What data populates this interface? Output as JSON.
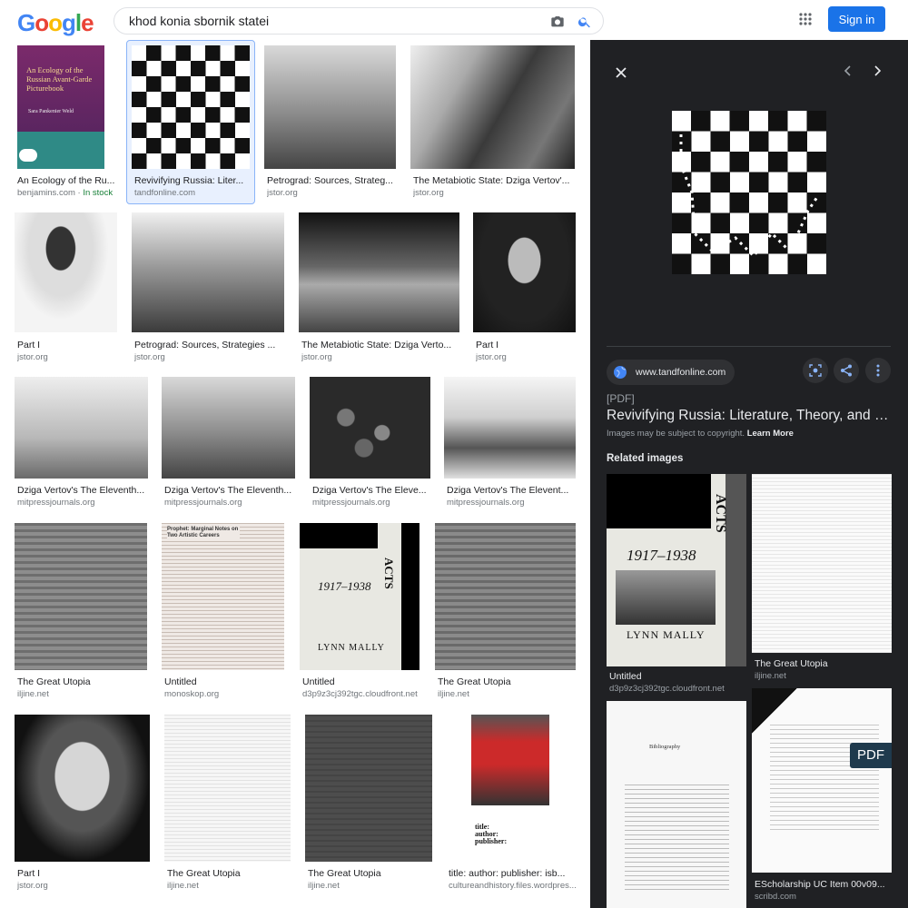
{
  "header": {
    "logo_letters": [
      "G",
      "o",
      "o",
      "g",
      "l",
      "e"
    ],
    "logo_colors": [
      "#4285f4",
      "#ea4335",
      "#fbbc05",
      "#4285f4",
      "#34a853",
      "#ea4335"
    ],
    "search_query": "khod konia sbornik statei",
    "signin_label": "Sign in"
  },
  "results": [
    {
      "title": "An Ecology of the Ru...",
      "source": "benjamins.com",
      "stock": "In stock",
      "cover_title": "An Ecology of the Russian Avant-Garde Picturebook",
      "cover_author": "Sara Pankenier Weld"
    },
    {
      "title": "Revivifying Russia: Liter...",
      "source": "tandfonline.com"
    },
    {
      "title": "Petrograd: Sources, Strateg...",
      "source": "jstor.org"
    },
    {
      "title": "The Metabiotic State: Dziga Vertov'...",
      "source": "jstor.org"
    },
    {
      "title": "Part I",
      "source": "jstor.org"
    },
    {
      "title": "Petrograd: Sources, Strategies ...",
      "source": "jstor.org"
    },
    {
      "title": "The Metabiotic State: Dziga Verto...",
      "source": "jstor.org"
    },
    {
      "title": "Part I",
      "source": "jstor.org"
    },
    {
      "title": "Dziga Vertov's The Eleventh...",
      "source": "mitpressjournals.org"
    },
    {
      "title": "Dziga Vertov's The Eleventh...",
      "source": "mitpressjournals.org"
    },
    {
      "title": "Dziga Vertov's The Eleve...",
      "source": "mitpressjournals.org"
    },
    {
      "title": "Dziga Vertov's The Elevent...",
      "source": "mitpressjournals.org"
    },
    {
      "title": "The Great Utopia",
      "source": "iljine.net"
    },
    {
      "title": "Untitled",
      "source": "monoskop.org",
      "doc_heading": "Prophet: Marginal Notes on Two Artistic Careers"
    },
    {
      "title": "Untitled",
      "source": "d3p9z3cj392tgc.cloudfront.net",
      "acts_word": "ACTS",
      "acts_years": "1917–1938",
      "acts_author": "LYNN MALLY"
    },
    {
      "title": "The Great Utopia",
      "source": "iljine.net"
    },
    {
      "title": "Part I",
      "source": "jstor.org"
    },
    {
      "title": "The Great Utopia",
      "source": "iljine.net"
    },
    {
      "title": "The Great Utopia",
      "source": "iljine.net"
    },
    {
      "title": "title: author: publisher: isb...",
      "source": "cultureandhistory.files.wordpres...",
      "doc_lines": [
        "title:",
        "author:",
        "publisher:"
      ]
    }
  ],
  "panel": {
    "site": "www.tandfonline.com",
    "type_tag": "[PDF]",
    "title": "Revivifying Russia: Literature, Theory, and E...",
    "copyright": "Images may be subject to copyright.",
    "learn_more": "Learn More",
    "related_heading": "Related images",
    "related": [
      {
        "title": "Untitled",
        "source": "d3p9z3cj392tgc.cloudfront.net",
        "acts_word": "ACTS",
        "acts_years": "1917–1938",
        "acts_author": "LYNN MALLY"
      },
      {
        "title": "The Great Utopia",
        "source": "iljine.net"
      },
      {
        "title": "",
        "source": "",
        "doc_heading": "Bibliography"
      },
      {
        "title": "EScholarship UC Item 00v09...",
        "source": "scribd.com",
        "badge": "PDF"
      }
    ]
  }
}
